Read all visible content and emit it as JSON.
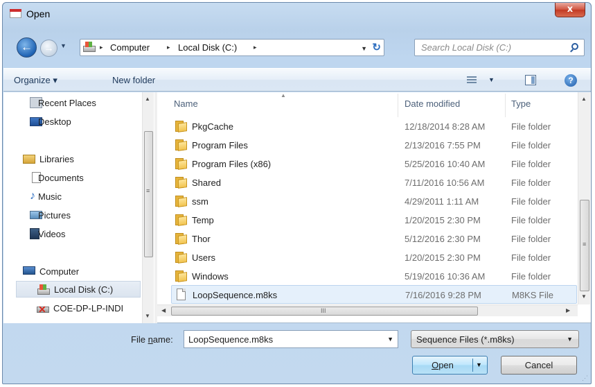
{
  "window": {
    "title": "Open",
    "close_glyph": "x"
  },
  "nav": {
    "back_glyph": "←",
    "forward_glyph": "→",
    "address": {
      "crumbs": [
        "Computer",
        "Local Disk (C:)"
      ],
      "separator": "▸",
      "refresh_glyph": "↻"
    },
    "search": {
      "placeholder": "Search Local Disk (C:)"
    }
  },
  "toolbar": {
    "organize_label": "Organize ▾",
    "new_folder_label": "New folder",
    "help_glyph": "?"
  },
  "sidebar": {
    "items": [
      {
        "label": "Recent Places",
        "icon": "recent-places-icon"
      },
      {
        "label": "Desktop",
        "icon": "desktop-icon"
      },
      {
        "label": "Libraries",
        "icon": "libraries-icon"
      },
      {
        "label": "Documents",
        "icon": "documents-icon"
      },
      {
        "label": "Music",
        "icon": "music-icon"
      },
      {
        "label": "Pictures",
        "icon": "pictures-icon"
      },
      {
        "label": "Videos",
        "icon": "videos-icon"
      },
      {
        "label": "Computer",
        "icon": "computer-icon"
      },
      {
        "label": "Local Disk (C:)",
        "icon": "local-disk-icon",
        "selected": true
      },
      {
        "label": "COE-DP-LP-INDI",
        "icon": "network-drive-icon"
      }
    ]
  },
  "file_list": {
    "columns": [
      "Name",
      "Date modified",
      "Type"
    ],
    "rows": [
      {
        "name": "PkgCache",
        "date": "12/18/2014 8:28 AM",
        "type": "File folder"
      },
      {
        "name": "Program Files",
        "date": "2/13/2016 7:55 PM",
        "type": "File folder"
      },
      {
        "name": "Program Files (x86)",
        "date": "5/25/2016 10:40 AM",
        "type": "File folder"
      },
      {
        "name": "Shared",
        "date": "7/11/2016 10:56 AM",
        "type": "File folder"
      },
      {
        "name": "ssm",
        "date": "4/29/2011 1:11 AM",
        "type": "File folder"
      },
      {
        "name": "Temp",
        "date": "1/20/2015 2:30 PM",
        "type": "File folder"
      },
      {
        "name": "Thor",
        "date": "5/12/2016 2:30 PM",
        "type": "File folder"
      },
      {
        "name": "Users",
        "date": "1/20/2015 2:30 PM",
        "type": "File folder"
      },
      {
        "name": "Windows",
        "date": "5/19/2016 10:36 AM",
        "type": "File folder"
      },
      {
        "name": "LoopSequence.m8ks",
        "date": "7/16/2016 9:28 PM",
        "type": "M8KS File",
        "selected": true
      }
    ]
  },
  "footer": {
    "file_name_label_pre": "File ",
    "file_name_label_underlined": "n",
    "file_name_label_post": "ame:",
    "file_name_value": "LoopSequence.m8ks",
    "file_type_value": "Sequence Files  (*.m8ks)",
    "open_label_underlined": "O",
    "open_label_rest": "pen",
    "cancel_label": "Cancel"
  },
  "colors": {
    "window_frame": "#bed6ef",
    "selection": "#e5f0fb",
    "accent_button": "#bde6fd"
  }
}
